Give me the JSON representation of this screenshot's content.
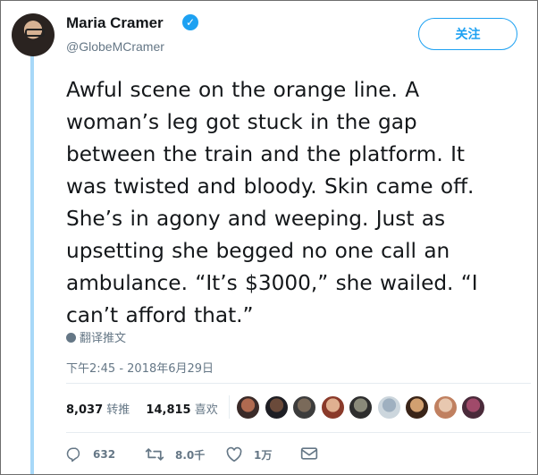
{
  "user": {
    "name": "Maria Cramer",
    "handle": "@GlobeMCramer",
    "verified_glyph": "✓"
  },
  "follow_label": "关注",
  "tweet_lines": [
    "Awful scene on the orange line. A",
    "woman’s leg got stuck in the gap",
    "between the train and the platform. It",
    "was twisted and bloody. Skin came off.",
    "She’s in agony and weeping. Just as",
    "upsetting she begged no one call an",
    "ambulance. “It’s $3000,” she wailed. “I",
    "can’t afford that.”"
  ],
  "translate_label": "翻译推文",
  "timestamp": "下午2:45 - 2018年6月29日",
  "stats": {
    "retweets_count": "8,037",
    "retweets_label": "转推",
    "likes_count": "14,815",
    "likes_label": "喜欢"
  },
  "liker_avatars": [
    {
      "colors": [
        "#b06a50",
        "#3a2a28"
      ]
    },
    {
      "colors": [
        "#6a4a3a",
        "#1e1e24"
      ]
    },
    {
      "colors": [
        "#7a6a5a",
        "#3c3c3c"
      ]
    },
    {
      "colors": [
        "#e0b090",
        "#8a3a2a"
      ]
    },
    {
      "colors": [
        "#8a8a7a",
        "#2e2e2e"
      ]
    },
    {
      "colors": [
        "#9fb0c0",
        "#ccd6dd"
      ]
    },
    {
      "colors": [
        "#d2a070",
        "#3a2418"
      ]
    },
    {
      "colors": [
        "#e8c8b0",
        "#c08060"
      ]
    },
    {
      "colors": [
        "#a04a6a",
        "#4a2a3a"
      ]
    }
  ],
  "actions": {
    "reply_count": "632",
    "retweet_count": "8.0千",
    "like_count": "1万"
  },
  "icons": {
    "reply": "reply-icon",
    "retweet": "retweet-icon",
    "like": "heart-icon",
    "dm": "envelope-icon",
    "translate": "globe-icon"
  }
}
